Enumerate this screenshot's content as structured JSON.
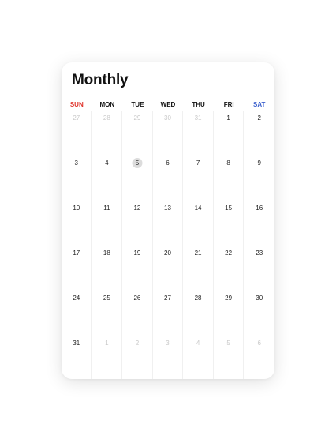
{
  "title": "Monthly",
  "colors": {
    "sunday": "#e0332b",
    "saturday": "#3a5fcd",
    "default": "#111111",
    "muted": "#c9c9c9",
    "today_bg": "#dcdcdc"
  },
  "weekdays": [
    "SUN",
    "MON",
    "TUE",
    "WED",
    "THU",
    "FRI",
    "SAT"
  ],
  "weeks": [
    [
      {
        "d": "27",
        "m": true
      },
      {
        "d": "28",
        "m": true
      },
      {
        "d": "29",
        "m": true
      },
      {
        "d": "30",
        "m": true
      },
      {
        "d": "31",
        "m": true
      },
      {
        "d": "1"
      },
      {
        "d": "2"
      }
    ],
    [
      {
        "d": "3"
      },
      {
        "d": "4"
      },
      {
        "d": "5",
        "today": true
      },
      {
        "d": "6"
      },
      {
        "d": "7"
      },
      {
        "d": "8"
      },
      {
        "d": "9"
      }
    ],
    [
      {
        "d": "10"
      },
      {
        "d": "11"
      },
      {
        "d": "12"
      },
      {
        "d": "13"
      },
      {
        "d": "14"
      },
      {
        "d": "15"
      },
      {
        "d": "16"
      }
    ],
    [
      {
        "d": "17"
      },
      {
        "d": "18"
      },
      {
        "d": "19"
      },
      {
        "d": "20"
      },
      {
        "d": "21"
      },
      {
        "d": "22"
      },
      {
        "d": "23"
      }
    ],
    [
      {
        "d": "24"
      },
      {
        "d": "25"
      },
      {
        "d": "26"
      },
      {
        "d": "27"
      },
      {
        "d": "28"
      },
      {
        "d": "29"
      },
      {
        "d": "30"
      }
    ],
    [
      {
        "d": "31"
      },
      {
        "d": "1",
        "m": true
      },
      {
        "d": "2",
        "m": true
      },
      {
        "d": "3",
        "m": true
      },
      {
        "d": "4",
        "m": true
      },
      {
        "d": "5",
        "m": true
      },
      {
        "d": "6",
        "m": true
      }
    ]
  ]
}
